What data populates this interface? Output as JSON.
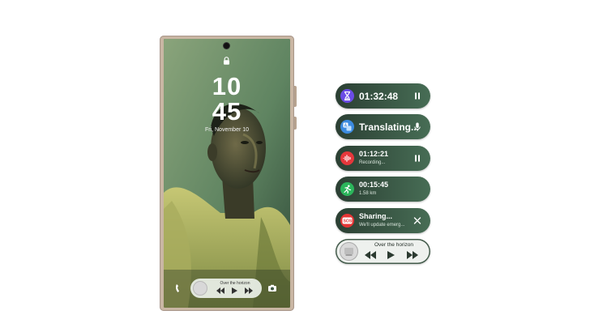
{
  "lockscreen": {
    "clock_hours": "10",
    "clock_minutes": "45",
    "date": "Fri, November 10",
    "media": {
      "title": "Over the horizon"
    }
  },
  "now_bar": [
    {
      "type": "timer",
      "icon": "hourglass-icon",
      "title": "01:32:48",
      "action": "pause-icon",
      "accent": "#6b4ce6"
    },
    {
      "type": "translate",
      "icon": "translate-icon",
      "title": "Translating...",
      "action": "microphone-icon",
      "accent": "#3c8be0"
    },
    {
      "type": "recording",
      "icon": "waveform-icon",
      "title": "01:12:21",
      "subtitle": "Recording...",
      "action": "pause-icon",
      "accent": "#e5373b"
    },
    {
      "type": "workout",
      "icon": "running-icon",
      "title": "00:15:45",
      "subtitle": "1.58 km",
      "accent": "#2bb55b"
    },
    {
      "type": "sos",
      "icon": "sos-icon",
      "title": "Sharing...",
      "subtitle": "We'll update emerg...",
      "action": "close-icon",
      "accent": "#e53535"
    },
    {
      "type": "media",
      "icon": "album-art",
      "title": "Over the horizon"
    }
  ]
}
